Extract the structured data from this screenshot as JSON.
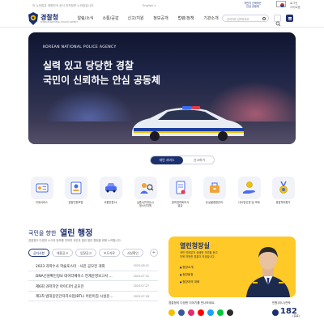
{
  "topbar": {
    "notice": "이 누리집은 대한민국 공식 전자정부 누리집입니다.",
    "lang": "English ∨",
    "slogan_line1": "국민이 신뢰하는",
    "slogan_line2": "안심 공동체",
    "right_line1": "로그인",
    "right_line2": "사이트맵"
  },
  "header": {
    "logo_title": "경찰청",
    "logo_subtitle": "KOREAN NATIONAL POLICE AGENCY",
    "nav": [
      "알림/소식",
      "소통/공감",
      "신고/지원",
      "정보공개",
      "법령/정책",
      "기관소개"
    ],
    "search_placeholder": "검색어를 입력하세요"
  },
  "hero": {
    "tag": "KOREAN NATIONAL POLICE AGENCY",
    "line1": "실력 있고 당당한 경찰",
    "line2": "국민이 신뢰하는 안심 공동체"
  },
  "tabs": {
    "active": "대민 서비스",
    "inactive": "신고하기"
  },
  "services": [
    {
      "label": "지워서비스",
      "icon": "id-card-icon"
    },
    {
      "label": "경찰민원포털",
      "icon": "portal-icon"
    },
    {
      "label": "교통민원24",
      "icon": "traffic-icon"
    },
    {
      "label": "실종/성착취(Li)\n청소년지원",
      "icon": "missing-person-icon"
    },
    {
      "label": "범죄경력회보서\n발급",
      "icon": "certificate-icon"
    },
    {
      "label": "유실물종합관리",
      "icon": "lost-item-icon"
    },
    {
      "label": "내사업신청 및 조회",
      "icon": "hand-coin-icon"
    },
    {
      "label": "경찰학위평가",
      "icon": "medal-icon"
    }
  ],
  "open_admin": {
    "subtitle": "국민을 향한",
    "title": "열린 행정",
    "description": "경찰청이 다양한 소식과 정보를 전하며 국민과 열린 열린 행정을 위해 노력합니다.",
    "filter_tabs": [
      "공지사항",
      "채용공고",
      "입찰공고",
      "보도자료",
      "사실확인"
    ],
    "more": "+",
    "news": [
      {
        "title": "2023 과학수사 학술포스터 · 사진 공모전 개최",
        "date": "2023.08.01"
      },
      {
        "title": "DNA신원확인정보 데이터베이스 연계운영보고서 ...",
        "date": "2023.07.31"
      },
      {
        "title": "제6회 과학치안 아이디어 공모전",
        "date": "2023.07.27"
      },
      {
        "title": "제3차 범대응민간자치사업(BTL) 어린이집 시설운...",
        "date": "2023.07.26"
      }
    ]
  },
  "commissioner": {
    "title": "열린청장실",
    "desc_line1": "국민 여러분의 생생한 의견을 듣고",
    "desc_line2": "더욱 따뜻한 경찰이 되겠습니다.",
    "links": [
      "청장소개",
      "청장동정",
      "청장과의 대화"
    ]
  },
  "sns": {
    "title": "경찰청의 다양한 이야기를 만나보세요.",
    "colors": [
      "#f2c200",
      "#3b5998",
      "#e1306c",
      "#ff0000",
      "#1da1f2",
      "#00c73c",
      "#2c2c2c"
    ]
  },
  "call": {
    "label": "민원(이나)연락",
    "number": "182",
    "suffix": "(유료)"
  }
}
